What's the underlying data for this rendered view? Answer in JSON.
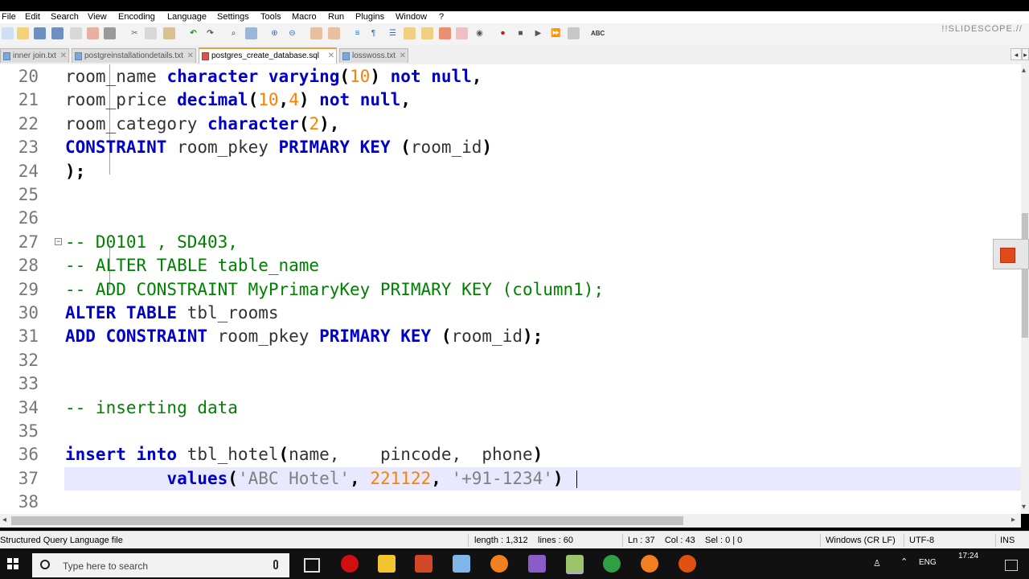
{
  "menu": [
    "File",
    "Edit",
    "Search",
    "View",
    "Encoding",
    "Language",
    "Settings",
    "Tools",
    "Macro",
    "Run",
    "Plugins",
    "Window",
    "?"
  ],
  "watermark": "!!SLIDESCOPE.//",
  "tabs": [
    {
      "label": "inner join.txt",
      "active": false
    },
    {
      "label": "postgreinstallationdetails.txt",
      "active": false
    },
    {
      "label": "postgres_create_database.sql",
      "active": true
    },
    {
      "label": "losswoss.txt",
      "active": false
    }
  ],
  "editor": {
    "lines": [
      {
        "num": "20",
        "tokens": [
          {
            "t": "room_name ",
            "c": "id"
          },
          {
            "t": "character varying",
            "c": "kw"
          },
          {
            "t": "(",
            "c": "op"
          },
          {
            "t": "10",
            "c": "num"
          },
          {
            "t": ")",
            "c": "op"
          },
          {
            "t": " ",
            "c": "id"
          },
          {
            "t": "not null",
            "c": "kw"
          },
          {
            "t": ",",
            "c": "op"
          }
        ]
      },
      {
        "num": "21",
        "tokens": [
          {
            "t": "room_price ",
            "c": "id"
          },
          {
            "t": "decimal",
            "c": "kw"
          },
          {
            "t": "(",
            "c": "op"
          },
          {
            "t": "10",
            "c": "num"
          },
          {
            "t": ",",
            "c": "op"
          },
          {
            "t": "4",
            "c": "num"
          },
          {
            "t": ")",
            "c": "op"
          },
          {
            "t": " ",
            "c": "id"
          },
          {
            "t": "not null",
            "c": "kw"
          },
          {
            "t": ",",
            "c": "op"
          }
        ]
      },
      {
        "num": "22",
        "tokens": [
          {
            "t": "room_category ",
            "c": "id"
          },
          {
            "t": "character",
            "c": "kw"
          },
          {
            "t": "(",
            "c": "op"
          },
          {
            "t": "2",
            "c": "num"
          },
          {
            "t": "),",
            "c": "op"
          }
        ]
      },
      {
        "num": "23",
        "tokens": [
          {
            "t": "CONSTRAINT",
            "c": "kw"
          },
          {
            "t": " room_pkey ",
            "c": "id"
          },
          {
            "t": "PRIMARY KEY",
            "c": "kw"
          },
          {
            "t": " ",
            "c": "id"
          },
          {
            "t": "(",
            "c": "op"
          },
          {
            "t": "room_id",
            "c": "id"
          },
          {
            "t": ")",
            "c": "op"
          }
        ]
      },
      {
        "num": "24",
        "tokens": [
          {
            "t": ");",
            "c": "op"
          }
        ]
      },
      {
        "num": "25",
        "tokens": []
      },
      {
        "num": "26",
        "tokens": []
      },
      {
        "num": "27",
        "tokens": [
          {
            "t": "-- D0101 , SD403,",
            "c": "cm"
          }
        ]
      },
      {
        "num": "28",
        "tokens": [
          {
            "t": "-- ALTER TABLE table_name",
            "c": "cm"
          }
        ]
      },
      {
        "num": "29",
        "tokens": [
          {
            "t": "-- ADD CONSTRAINT MyPrimaryKey PRIMARY KEY (column1);",
            "c": "cm"
          }
        ]
      },
      {
        "num": "30",
        "tokens": [
          {
            "t": "ALTER TABLE",
            "c": "kw"
          },
          {
            "t": " tbl_rooms",
            "c": "id"
          }
        ]
      },
      {
        "num": "31",
        "tokens": [
          {
            "t": "ADD CONSTRAINT",
            "c": "kw"
          },
          {
            "t": " room_pkey ",
            "c": "id"
          },
          {
            "t": "PRIMARY KEY",
            "c": "kw"
          },
          {
            "t": " ",
            "c": "id"
          },
          {
            "t": "(",
            "c": "op"
          },
          {
            "t": "room_id",
            "c": "id"
          },
          {
            "t": ");",
            "c": "op"
          }
        ]
      },
      {
        "num": "32",
        "tokens": []
      },
      {
        "num": "33",
        "tokens": []
      },
      {
        "num": "34",
        "tokens": [
          {
            "t": "-- inserting data",
            "c": "cm"
          }
        ]
      },
      {
        "num": "35",
        "tokens": []
      },
      {
        "num": "36",
        "tokens": [
          {
            "t": "insert into",
            "c": "kw"
          },
          {
            "t": " tbl_hotel",
            "c": "id"
          },
          {
            "t": "(",
            "c": "op"
          },
          {
            "t": "name,    pincode,  phone",
            "c": "id"
          },
          {
            "t": ")",
            "c": "op"
          }
        ]
      },
      {
        "num": "37",
        "tokens": [
          {
            "t": "          ",
            "c": "id"
          },
          {
            "t": "values",
            "c": "kw"
          },
          {
            "t": "(",
            "c": "op"
          },
          {
            "t": "'ABC Hotel'",
            "c": "str"
          },
          {
            "t": ", ",
            "c": "op"
          },
          {
            "t": "221122",
            "c": "num"
          },
          {
            "t": ", ",
            "c": "op"
          },
          {
            "t": "'+91-1234'",
            "c": "str"
          },
          {
            "t": ")",
            "c": "op"
          }
        ]
      },
      {
        "num": "38",
        "tokens": []
      }
    ]
  },
  "status": {
    "filetype": "Structured Query Language file",
    "length": "length : 1,312",
    "lines": "lines : 60",
    "position": "Ln : 37    Col : 43    Sel : 0 | 0",
    "eol": "Windows (CR LF)",
    "encoding": "UTF-8",
    "mode": "INS"
  },
  "taskbar": {
    "search_placeholder": "Type here to search",
    "lang": "ENG",
    "time": "17:24"
  }
}
